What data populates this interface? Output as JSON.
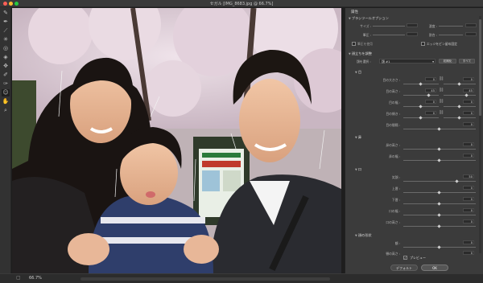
{
  "window": {
    "title": "セガル [IMG_8683.jpg @ 66.7%]",
    "colors": {
      "close": "#fc5f57",
      "minimize": "#fdbb2e",
      "maximize": "#28c840"
    }
  },
  "tools": [
    "brush-icon",
    "pen-icon",
    "line-icon",
    "sparkle-icon",
    "bloat-icon",
    "pucker-icon",
    "move-icon",
    "freeze-mask-icon",
    "thaw-mask-icon",
    "face-tool-icon",
    "hand-icon",
    "zoom-icon"
  ],
  "status": {
    "zoom": "66.7%"
  },
  "panel": {
    "title": "属性",
    "brush_section": "ブラシツールオプション",
    "brush_labels": [
      "サイズ :",
      "濃度 :",
      "筆圧 :",
      "割合 :"
    ],
    "brush_checkbox_left": "筆圧を使用",
    "brush_checkbox_right": "エッジをピン留め固定",
    "face_section": "顔立ちを調整",
    "face_select_label": "顔を選択 :",
    "face_select_value": "顔 #1",
    "reset_label": "初期化",
    "all_label": "すべて",
    "eyes_section": "目",
    "eye_rows": [
      {
        "label": "目の大きさ :",
        "left": "0",
        "right": "0"
      },
      {
        "label": "目の高さ :",
        "left": "45",
        "right": "45"
      },
      {
        "label": "目の幅 :",
        "left": "0",
        "right": "0"
      },
      {
        "label": "目の傾き :",
        "left": "0",
        "right": "0"
      },
      {
        "label": "目の間隔 :",
        "value": "0"
      }
    ],
    "nose_section": "鼻",
    "nose_rows": [
      {
        "label": "鼻の高さ :",
        "value": "0"
      },
      {
        "label": "鼻の幅 :",
        "value": "0"
      }
    ],
    "mouth_section": "口",
    "mouth_rows": [
      {
        "label": "笑顔 :",
        "value": "50"
      },
      {
        "label": "上唇 :",
        "value": "0"
      },
      {
        "label": "下唇 :",
        "value": "0"
      },
      {
        "label": "口の幅 :",
        "value": "0"
      },
      {
        "label": "口の高さ :",
        "value": "0"
      }
    ],
    "shape_section": "顔の形状",
    "shape_rows": [
      {
        "label": "額 :",
        "value": "0"
      },
      {
        "label": "顎の高さ :",
        "value": "0"
      }
    ],
    "preview_label": "プレビュー",
    "preview_checked": "✓",
    "default_button": "デフォルト",
    "ok_button": "OK"
  }
}
